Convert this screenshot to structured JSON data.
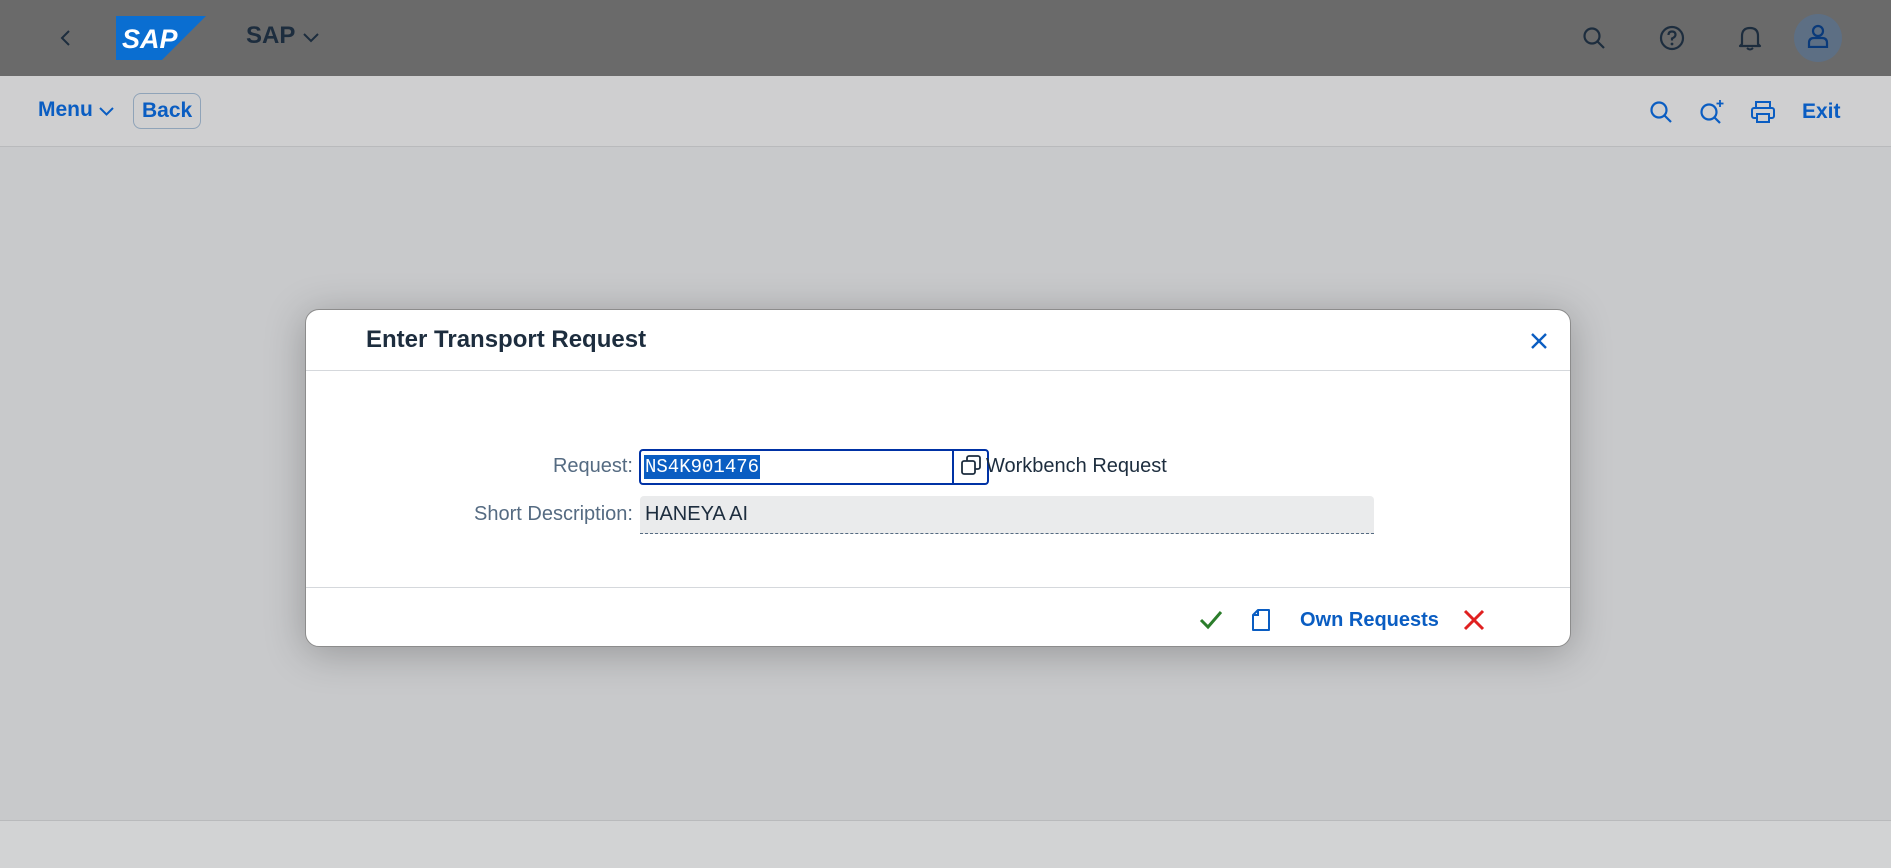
{
  "shell": {
    "logo_text": "SAP",
    "title": "SAP",
    "icons": [
      "back-icon",
      "search-icon",
      "help-icon",
      "bell-icon",
      "user-icon"
    ]
  },
  "toolbar": {
    "menu_label": "Menu",
    "back_label": "Back",
    "exit_label": "Exit",
    "icons": [
      "find-icon",
      "find-next-icon",
      "print-icon"
    ]
  },
  "dialog": {
    "title": "Enter Transport Request",
    "request_label": "Request:",
    "request_value": "NS4K901476",
    "request_type": "Workbench Request",
    "short_desc_label": "Short Description:",
    "short_desc_value": "HANEYA AI",
    "own_requests_label": "Own Requests",
    "icons": [
      "close-icon",
      "value-help-icon",
      "confirm-icon",
      "new-document-icon",
      "cancel-icon"
    ]
  },
  "colors": {
    "shell_bg": "#6a6a6a",
    "link": "#0a5dc2",
    "confirm": "#2b7d2b",
    "cancel": "#e02020",
    "focus": "#0032a5"
  }
}
